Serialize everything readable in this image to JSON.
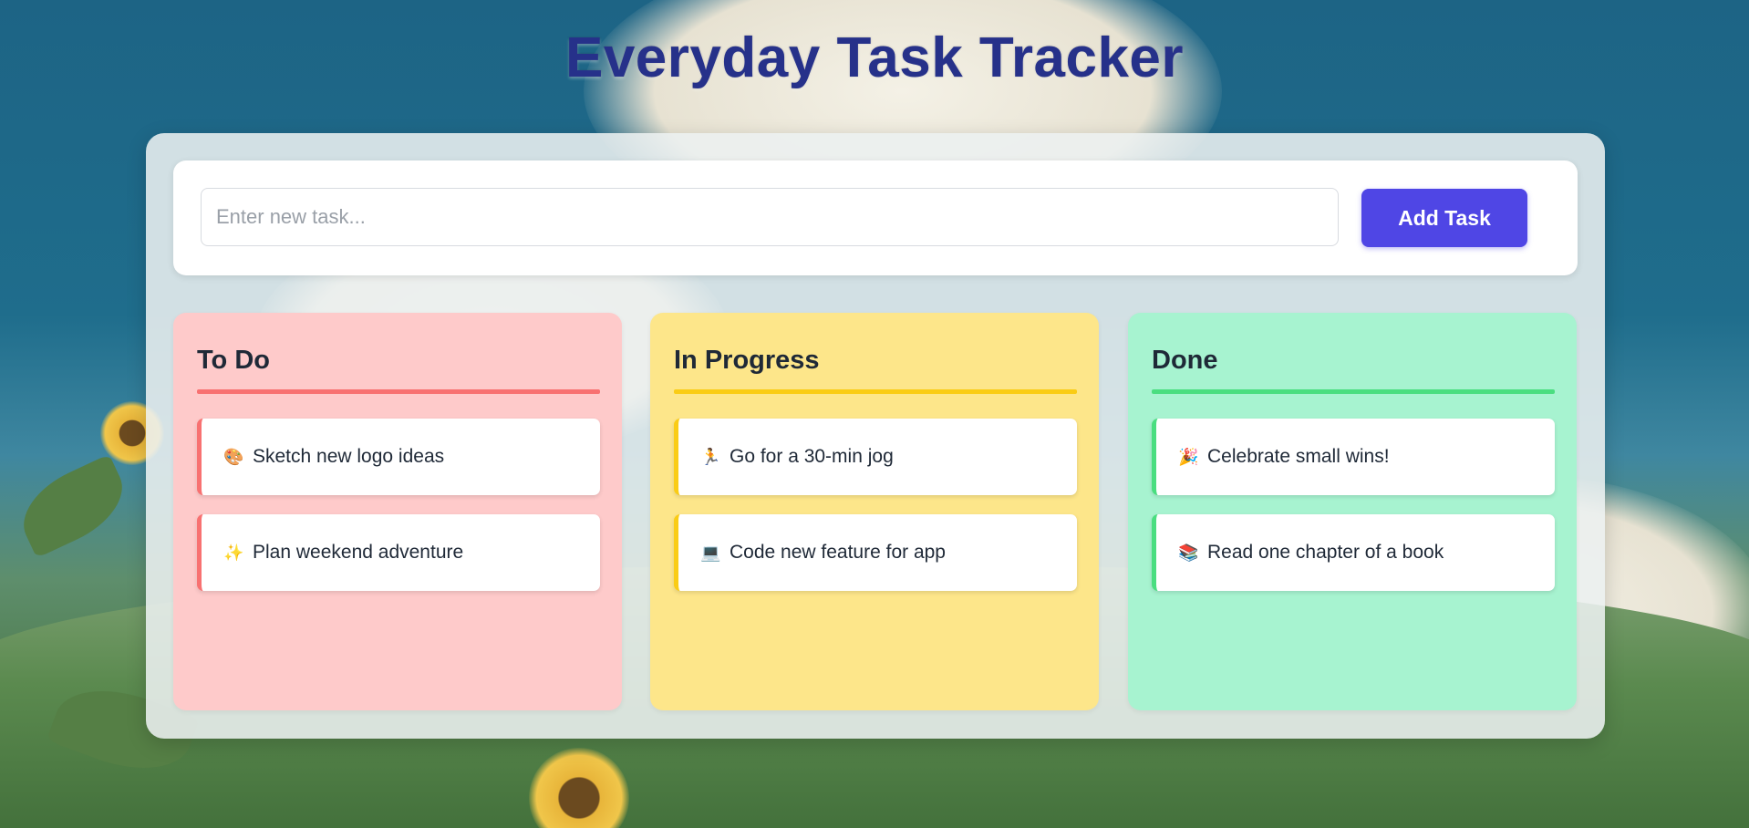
{
  "app": {
    "title": "Everyday Task Tracker"
  },
  "add_task": {
    "placeholder": "Enter new task...",
    "value": "",
    "button_label": "Add Task"
  },
  "columns": [
    {
      "title": "To Do",
      "accent": "#f87171",
      "background": "#fecaca",
      "tasks": [
        {
          "emoji": "🎨",
          "text": "Sketch new logo ideas"
        },
        {
          "emoji": "✨",
          "text": "Plan weekend adventure"
        }
      ]
    },
    {
      "title": "In Progress",
      "accent": "#facc15",
      "background": "#fde68a",
      "tasks": [
        {
          "emoji": "🏃",
          "text": "Go for a 30-min jog"
        },
        {
          "emoji": "💻",
          "text": "Code new feature for app"
        }
      ]
    },
    {
      "title": "Done",
      "accent": "#4ade80",
      "background": "#a7f3d0",
      "tasks": [
        {
          "emoji": "🎉",
          "text": "Celebrate small wins!"
        },
        {
          "emoji": "📚",
          "text": "Read one chapter of a book"
        }
      ]
    }
  ],
  "colors": {
    "title": "#26318a",
    "button": "#4f46e5"
  }
}
